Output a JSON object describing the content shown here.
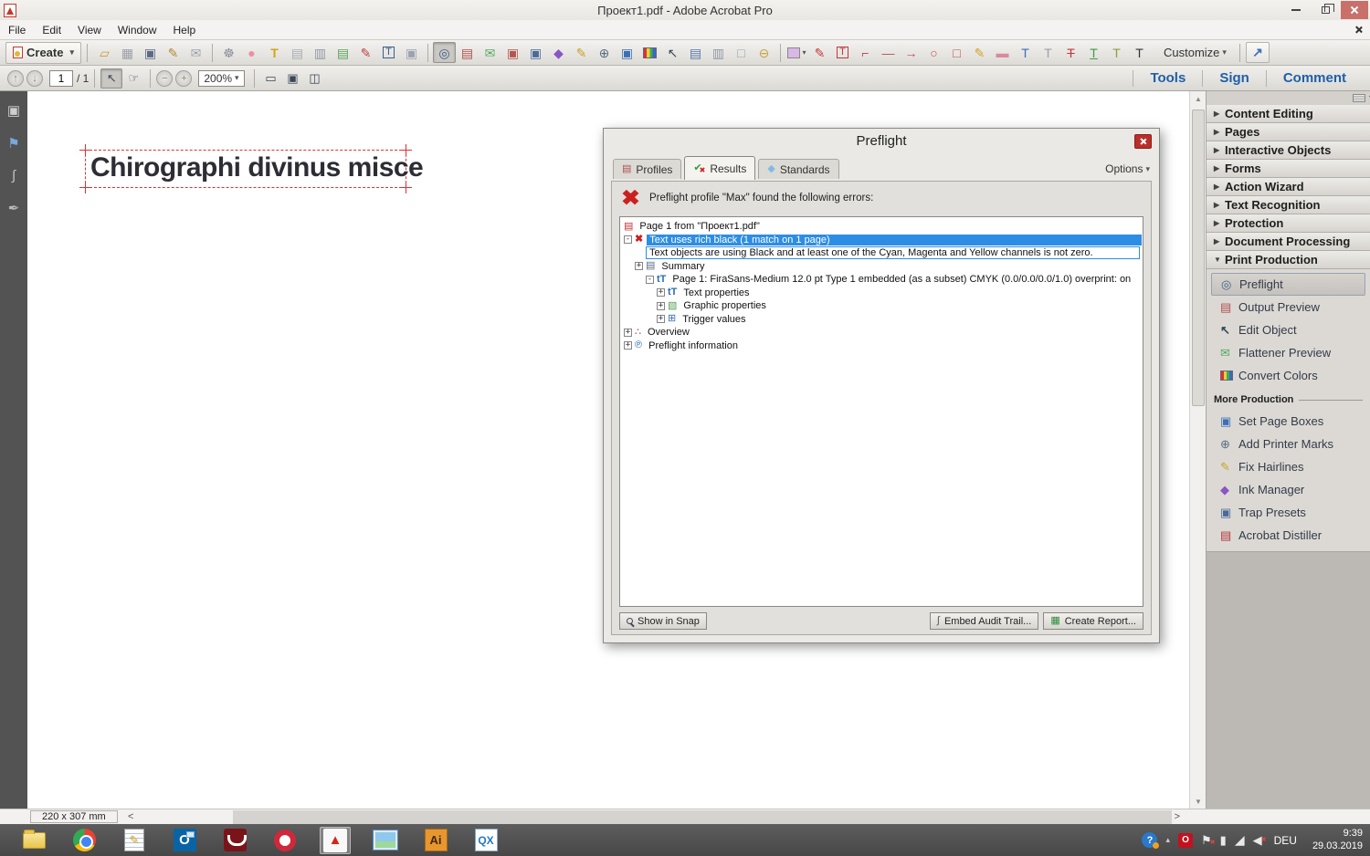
{
  "titlebar": {
    "title": "Проект1.pdf - Adobe Acrobat Pro"
  },
  "menubar": {
    "items": [
      {
        "label": "File"
      },
      {
        "label": "Edit"
      },
      {
        "label": "View"
      },
      {
        "label": "Window"
      },
      {
        "label": "Help"
      }
    ]
  },
  "toolbar": {
    "create_label": "Create",
    "customize_label": "Customize",
    "expand_glyph": "↗",
    "icons": [
      {
        "name": "open-file-icon",
        "g": "▱",
        "cs": "color:#c99a3a"
      },
      {
        "name": "save-icon",
        "g": "▦",
        "cs": "color:#9aa1a9"
      },
      {
        "name": "print-icon",
        "g": "▣",
        "cs": "color:#5b6a85"
      },
      {
        "name": "sign-document-icon",
        "g": "✎",
        "cs": "color:#b5893a"
      },
      {
        "name": "email-icon",
        "g": "✉",
        "cs": "color:#9aa1a9"
      },
      {
        "name": "divider",
        "g": "",
        "cs": ""
      },
      {
        "name": "gear-icon",
        "g": "☸",
        "cs": "color:#8a8f98"
      },
      {
        "name": "comment-bubble-icon",
        "g": "●",
        "cs": "color:#ee8fa0"
      },
      {
        "name": "highlight-text-icon",
        "g": "T",
        "cs": "color:#d1a516;font-weight:bold"
      },
      {
        "name": "delete-pages-icon",
        "g": "▤",
        "cs": "color:#a8adb5"
      },
      {
        "name": "find-document-icon",
        "g": "▥",
        "cs": "color:#8f98a5"
      },
      {
        "name": "export-file-icon",
        "g": "▤",
        "cs": "color:#58a55c"
      },
      {
        "name": "edit-document-icon",
        "g": "✎",
        "cs": "color:#c04343"
      },
      {
        "name": "add-text-box-icon",
        "g": "T",
        "cs": "color:#39608c"
      },
      {
        "name": "pages-icon",
        "g": "▣",
        "cs": "color:#9aa2ae"
      },
      {
        "name": "divider",
        "g": "",
        "cs": ""
      },
      {
        "name": "preflight-icon",
        "g": "◎",
        "cs": "color:#3b5e8c",
        "state": "pressed"
      },
      {
        "name": "output-preview-icon",
        "g": "▤",
        "cs": "color:#b34d4d"
      },
      {
        "name": "flattener-preview-icon",
        "g": "✉",
        "cs": "color:#58a85c"
      },
      {
        "name": "copy-pages-icon",
        "g": "▣",
        "cs": "color:#b3554f"
      },
      {
        "name": "trap-presets-icon",
        "g": "▣",
        "cs": "color:#4a6a9a"
      },
      {
        "name": "ink-manager-icon",
        "g": "◆",
        "cs": "color:#8a56c2"
      },
      {
        "name": "fix-hairlines-icon",
        "g": "✎",
        "cs": "color:#c9a227"
      },
      {
        "name": "add-printer-marks-icon",
        "g": "⊕",
        "cs": "color:#5a6b84"
      },
      {
        "name": "set-page-boxes-icon",
        "g": "▣",
        "cs": "color:#3b6fb5"
      },
      {
        "name": "convert-colors-icon",
        "g": "",
        "cs": ""
      },
      {
        "name": "edit-object-icon",
        "g": "↖",
        "cs": "color:#34495e"
      },
      {
        "name": "output-settings-icon",
        "g": "▤",
        "cs": "color:#5577aa"
      },
      {
        "name": "optimize-pdf-icon",
        "g": "▥",
        "cs": "color:#8f98a5"
      },
      {
        "name": "new-page-icon",
        "g": "□",
        "cs": "color:#9aa1a9"
      },
      {
        "name": "distiller-icon",
        "g": "⊖",
        "cs": "color:#c9a43f"
      },
      {
        "name": "divider",
        "g": "",
        "cs": ""
      },
      {
        "name": "color-swatch-icon",
        "g": "",
        "cs": ""
      },
      {
        "name": "annotate-pen-icon",
        "g": "✎",
        "cs": "color:#c03a3a"
      },
      {
        "name": "text-box-annot-icon",
        "g": "T",
        "cs": "color:#c03a3a"
      },
      {
        "name": "callout-icon",
        "g": "⌐",
        "cs": "color:#c05050"
      },
      {
        "name": "line-icon",
        "g": "—",
        "cs": "color:#c05050"
      },
      {
        "name": "arrow-icon",
        "g": "→",
        "cs": "color:#c05050"
      },
      {
        "name": "circle-icon",
        "g": "○",
        "cs": "color:#c05050"
      },
      {
        "name": "square-icon",
        "g": "□",
        "cs": "color:#c05050"
      },
      {
        "name": "pencil-icon",
        "g": "✎",
        "cs": "color:#d1a32c"
      },
      {
        "name": "eraser-icon",
        "g": "▬",
        "cs": "color:#d98a9c"
      },
      {
        "name": "insert-text-icon",
        "g": "T",
        "cs": "color:#3b6fb5"
      },
      {
        "name": "replace-text-icon",
        "g": "T",
        "cs": "color:#9aa0a8"
      },
      {
        "name": "strikethrough-text-icon",
        "g": "T",
        "cs": "color:#c03a3a;text-decoration:line-through"
      },
      {
        "name": "underline-text-icon",
        "g": "T",
        "cs": "color:#3f9c46;text-decoration:underline"
      },
      {
        "name": "text-note-icon",
        "g": "T",
        "cs": "color:#97993d"
      },
      {
        "name": "add-text-tool-icon",
        "g": "T",
        "cs": "color:#333333"
      }
    ]
  },
  "navbar": {
    "page_value": "1",
    "page_total": "/ 1",
    "zoom_value": "200%",
    "icons": {
      "prev": "↑",
      "next": "↓",
      "select": "↖",
      "hand": "☞",
      "minus": "−",
      "plus": "+",
      "scroll": "▭",
      "fit": "▣",
      "two": "◫"
    },
    "links": [
      {
        "label": "Tools"
      },
      {
        "label": "Sign"
      },
      {
        "label": "Comment"
      }
    ]
  },
  "leftrail": {
    "icons": [
      {
        "name": "page-thumbnails-icon",
        "g": "▣",
        "cs": "color:#cfcfcf"
      },
      {
        "name": "bookmarks-icon",
        "g": "⚑",
        "cs": "color:#7aa8dc"
      },
      {
        "name": "attachments-icon",
        "g": "∫",
        "cs": "color:#c2c2c2"
      },
      {
        "name": "signatures-icon",
        "g": "✒",
        "cs": "color:#b8b8b8"
      }
    ]
  },
  "document": {
    "text": "Chirographi divinus misce",
    "size_label": "220 x 307 mm"
  },
  "dialog": {
    "title": "Preflight",
    "options_label": "Options",
    "tabs": [
      {
        "label": "Profiles",
        "icon": "profiles-icon",
        "g": "▤",
        "cs": "color:#b05050",
        "state": ""
      },
      {
        "label": "Results",
        "icon": "results-icon",
        "g": "✔",
        "cs": "color:#2e9e3a",
        "state": "active"
      },
      {
        "label": "Standards",
        "icon": "standards-icon",
        "g": "◆",
        "cs": "color:#85b8e8",
        "state": ""
      }
    ],
    "error_message": "Preflight profile \"Max\" found the following errors:",
    "tree": [
      {
        "label": "Page 1 from \"Проект1.pdf\"",
        "ind": "0",
        "exp": "",
        "icon": "pdf-page-icon",
        "ig": "▤",
        "ics": "color:#c03030",
        "state": ""
      },
      {
        "label": "Text uses rich black (1 match on 1 page)",
        "ind": "0",
        "exp": "-",
        "icon": "error-x-icon",
        "ig": "✖",
        "ics": "color:#cc1f1f;font-weight:bold",
        "state": "selected"
      },
      {
        "label": "Text objects are using Black and at least one of the Cyan, Magenta and Yellow channels is not zero.",
        "ind": "2",
        "exp": "",
        "icon": "",
        "ig": "",
        "ics": "",
        "state": "outlined"
      },
      {
        "label": "Summary",
        "ind": "1",
        "exp": "+",
        "icon": "summary-icon",
        "ig": "▤",
        "ics": "color:#5a6b85",
        "state": ""
      },
      {
        "label": "Page 1: FiraSans-Medium 12.0 pt Type 1  embedded (as a subset) CMYK (0.0/0.0/0.0/1.0)  overprint: on",
        "ind": "2",
        "exp": "-",
        "icon": "font-info-icon",
        "ig": "tT",
        "ics": "color:#2b6cb5;font-weight:bold",
        "state": ""
      },
      {
        "label": "Text properties",
        "ind": "3",
        "exp": "+",
        "icon": "text-properties-icon",
        "ig": "tT",
        "ics": "color:#2b6cb5;font-weight:bold",
        "state": ""
      },
      {
        "label": "Graphic properties",
        "ind": "3",
        "exp": "+",
        "icon": "graphic-properties-icon",
        "ig": "▧",
        "ics": "color:#55a055",
        "state": ""
      },
      {
        "label": "Trigger values",
        "ind": "3",
        "exp": "+",
        "icon": "trigger-values-icon",
        "ig": "⊞",
        "ics": "color:#3b6fb5",
        "state": ""
      },
      {
        "label": "Overview",
        "ind": "0",
        "exp": "+",
        "icon": "overview-icon",
        "ig": "∴",
        "ics": "color:#b04040",
        "state": ""
      },
      {
        "label": "Preflight information",
        "ind": "0",
        "exp": "+",
        "icon": "preflight-info-icon",
        "ig": "℗",
        "ics": "color:#2b6cb5",
        "state": ""
      }
    ],
    "footer": {
      "show_in_snap": "Show in Snap",
      "embed_audit_trail": "Embed Audit Trail...",
      "create_report": "Create Report...",
      "audit_glyph": "∫",
      "report_glyph": "▦"
    }
  },
  "sidebar": {
    "panels": [
      {
        "label": "Content Editing",
        "arrow": "▶"
      },
      {
        "label": "Pages",
        "arrow": "▶"
      },
      {
        "label": "Interactive Objects",
        "arrow": "▶"
      },
      {
        "label": "Forms",
        "arrow": "▶"
      },
      {
        "label": "Action Wizard",
        "arrow": "▶"
      },
      {
        "label": "Text Recognition",
        "arrow": "▶"
      },
      {
        "label": "Protection",
        "arrow": "▶"
      },
      {
        "label": "Document Processing",
        "arrow": "▶"
      },
      {
        "label": "Print Production",
        "arrow": "▼"
      }
    ],
    "tools": [
      {
        "label": "Preflight",
        "icon": "preflight-tool-icon",
        "g": "◎",
        "cs": "color:#3b5e8c",
        "state": "selected"
      },
      {
        "label": "Output Preview",
        "icon": "output-preview-tool-icon",
        "g": "▤",
        "cs": "color:#b34d4d",
        "state": ""
      },
      {
        "label": "Edit Object",
        "icon": "edit-object-tool-icon",
        "g": "↖",
        "cs": "color:#34495e;font-weight:bold",
        "state": ""
      },
      {
        "label": "Flattener Preview",
        "icon": "flattener-preview-tool-icon",
        "g": "✉",
        "cs": "color:#58a85c",
        "state": ""
      },
      {
        "label": "Convert Colors",
        "icon": "convert-colors-icon",
        "g": "",
        "cs": "",
        "state": ""
      }
    ],
    "more_label": "More Production",
    "more_tools": [
      {
        "label": "Set Page Boxes",
        "icon": "set-page-boxes-tool-icon",
        "g": "▣",
        "cs": "color:#3b6fb5"
      },
      {
        "label": "Add Printer Marks",
        "icon": "add-printer-marks-tool-icon",
        "g": "⊕",
        "cs": "color:#5a6b84"
      },
      {
        "label": "Fix Hairlines",
        "icon": "fix-hairlines-tool-icon",
        "g": "✎",
        "cs": "color:#c9a227"
      },
      {
        "label": "Ink Manager",
        "icon": "ink-manager-tool-icon",
        "g": "◆",
        "cs": "color:#8a56c2"
      },
      {
        "label": "Trap Presets",
        "icon": "trap-presets-tool-icon",
        "g": "▣",
        "cs": "color:#4a6a9a"
      },
      {
        "label": "Acrobat Distiller",
        "icon": "acrobat-distiller-icon",
        "g": "▤",
        "cs": "color:#b03535"
      }
    ]
  },
  "statusbar": {
    "size_label": "220 x 307 mm",
    "left_arrow": "<",
    "right_arrow": ">"
  },
  "taskbar": {
    "apps": [
      {
        "name": "explorer-icon",
        "g": "",
        "cs": ""
      },
      {
        "name": "chrome-icon",
        "g": "",
        "cs": ""
      },
      {
        "name": "notepad-icon",
        "g": "✎",
        "cs": "color:#c9a227"
      },
      {
        "name": "outlook-icon",
        "g": "O",
        "cs": ""
      },
      {
        "name": "reader-icon",
        "g": "",
        "cs": ""
      },
      {
        "name": "opera-icon",
        "g": "",
        "cs": ""
      },
      {
        "name": "acrobat-icon",
        "g": "▲",
        "cs": "color:#d3271e",
        "state": "active"
      },
      {
        "name": "photos-icon",
        "g": "",
        "cs": ""
      },
      {
        "name": "illustrator-icon",
        "g": "Ai",
        "cs": ""
      },
      {
        "name": "quark-icon",
        "g": "QX",
        "cs": ""
      }
    ],
    "tray": [
      {
        "name": "help-icon",
        "g": "?",
        "cs": ""
      },
      {
        "name": "chevron-up-icon",
        "g": "▴",
        "cs": ""
      },
      {
        "name": "opera-tray-icon",
        "g": "O",
        "cs": ""
      },
      {
        "name": "action-center-flag-icon",
        "g": "⚑",
        "cs": ""
      },
      {
        "name": "power-icon",
        "g": "▮",
        "cs": ""
      },
      {
        "name": "network-signal-icon",
        "g": "◢",
        "cs": ""
      },
      {
        "name": "volume-muted-icon",
        "g": "◀",
        "cs": ""
      }
    ],
    "language": "DEU",
    "time": "9:39",
    "date": "29.03.2019"
  }
}
